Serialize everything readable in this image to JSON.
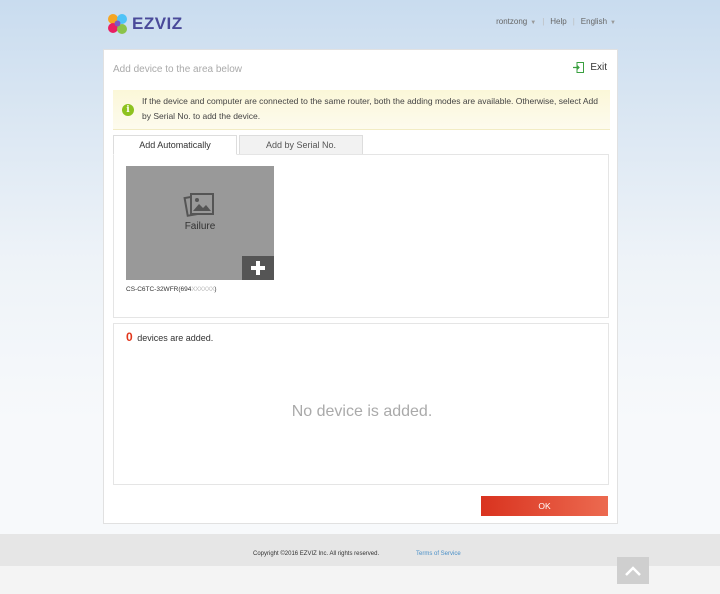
{
  "header": {
    "logo_text": "EZVIZ",
    "user": "rontzong",
    "help": "Help",
    "language": "English"
  },
  "panel": {
    "title": "Add device to the area below",
    "exit_label": "Exit",
    "notice": "If the device and computer are connected to the same router, both the adding modes are available. Otherwise, select Add by Serial No. to add the device.",
    "tabs": [
      {
        "label": "Add Automatically",
        "active": true
      },
      {
        "label": "Add by Serial No.",
        "active": false
      }
    ],
    "device": {
      "status": "Failure",
      "name": "CS-C6TC-32WFR(694",
      "name_obscured": "XXXXXX",
      "name_suffix": ")"
    },
    "added": {
      "count": "0",
      "count_label": "devices are added.",
      "empty_message": "No device is added."
    },
    "ok_label": "OK"
  },
  "footer": {
    "copyright": "Copyright ©2016 EZVIZ Inc. All rights reserved.",
    "terms": "Terms of Service"
  },
  "colors": {
    "accent_red": "#e2361b",
    "info_green": "#8dc21f",
    "link_blue": "#4a90c8"
  },
  "icons": [
    "ezviz-logo-icon",
    "exit-icon",
    "info-icon",
    "image-icon",
    "plus-icon",
    "back-to-top-icon",
    "chevron-down-icon"
  ]
}
